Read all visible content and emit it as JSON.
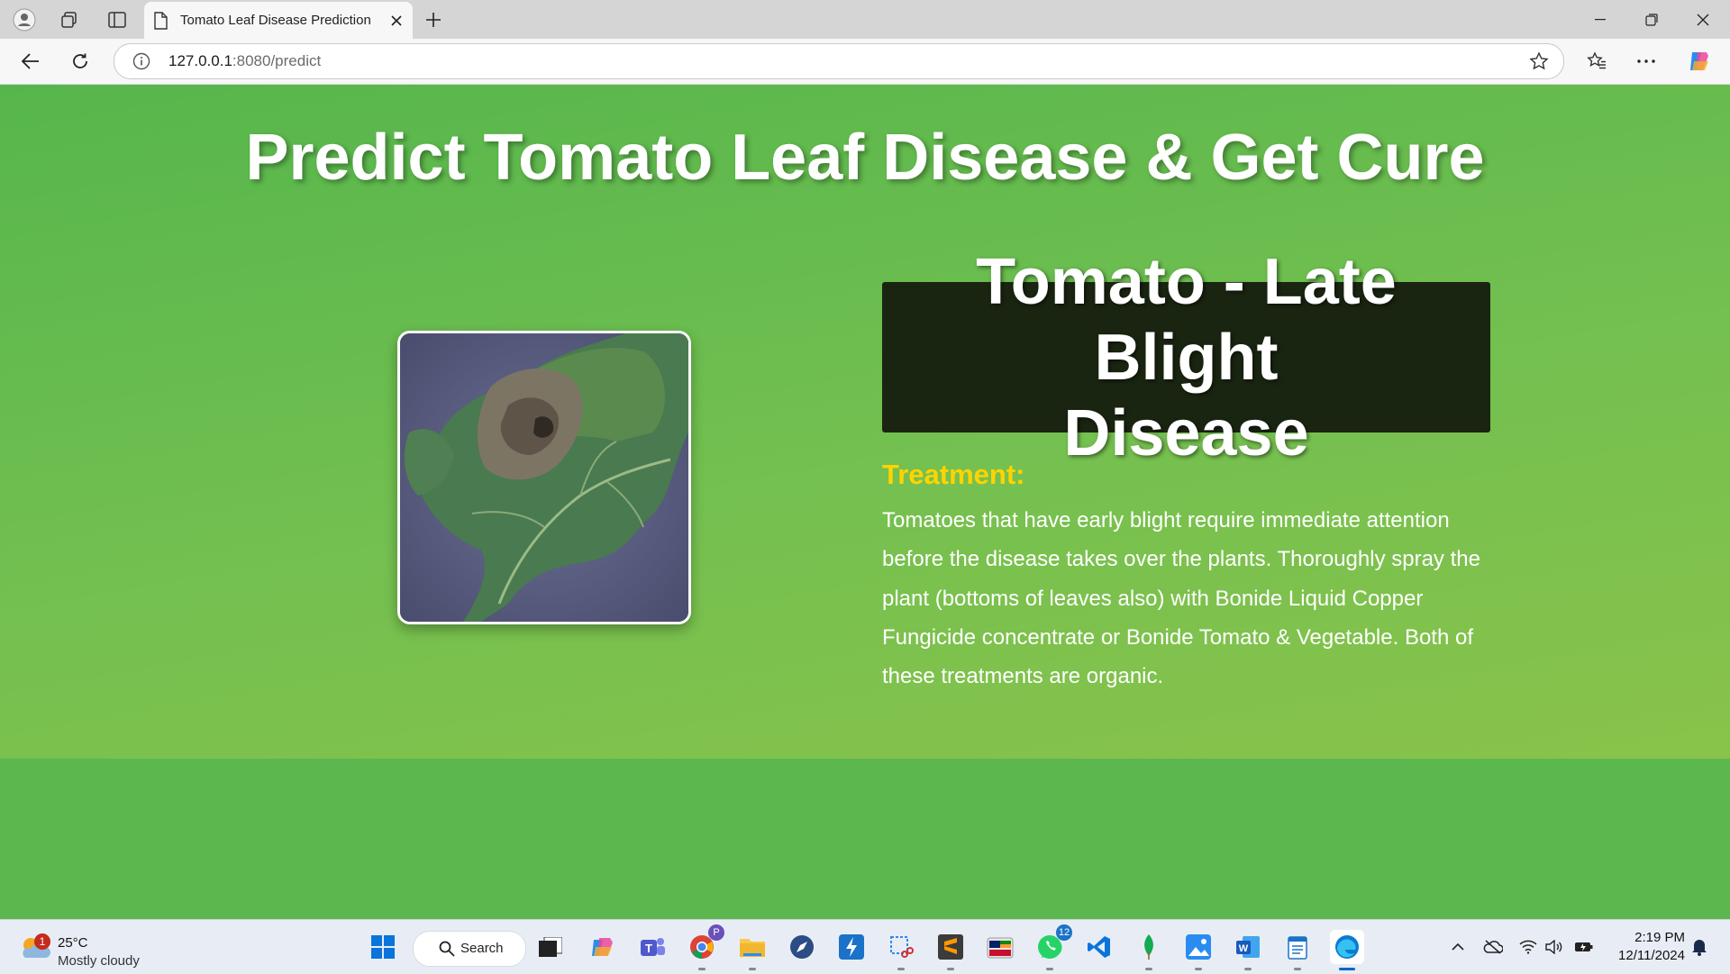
{
  "browser": {
    "tab_title": "Tomato Leaf Disease Prediction",
    "url_host": "127.0.0.1",
    "url_path": ":8080/predict"
  },
  "page": {
    "heading": "Predict Tomato Leaf Disease & Get Cure",
    "image_alt": "Tomato leaf with late blight lesion",
    "disease_line1": "Tomato - Late Blight",
    "disease_line2": "Disease",
    "treatment_label": "Treatment:",
    "treatment_text": "Tomatoes that have early blight require immediate attention before the disease takes over the plants. Thoroughly spray the plant (bottoms of leaves also) with Bonide Liquid Copper Fungicide concentrate or Bonide Tomato & Vegetable. Both of these treatments are organic."
  },
  "taskbar": {
    "weather_temp": "25°C",
    "weather_desc": "Mostly cloudy",
    "weather_badge": "1",
    "search_label": "Search",
    "chrome_badge": "P",
    "whatsapp_badge": "12",
    "time": "2:19 PM",
    "date": "12/11/2024"
  },
  "colors": {
    "page_green": "#5cb84e",
    "heading_white": "#ffffff",
    "disease_box": "#1a2511",
    "treatment_yellow": "#ffd400"
  }
}
